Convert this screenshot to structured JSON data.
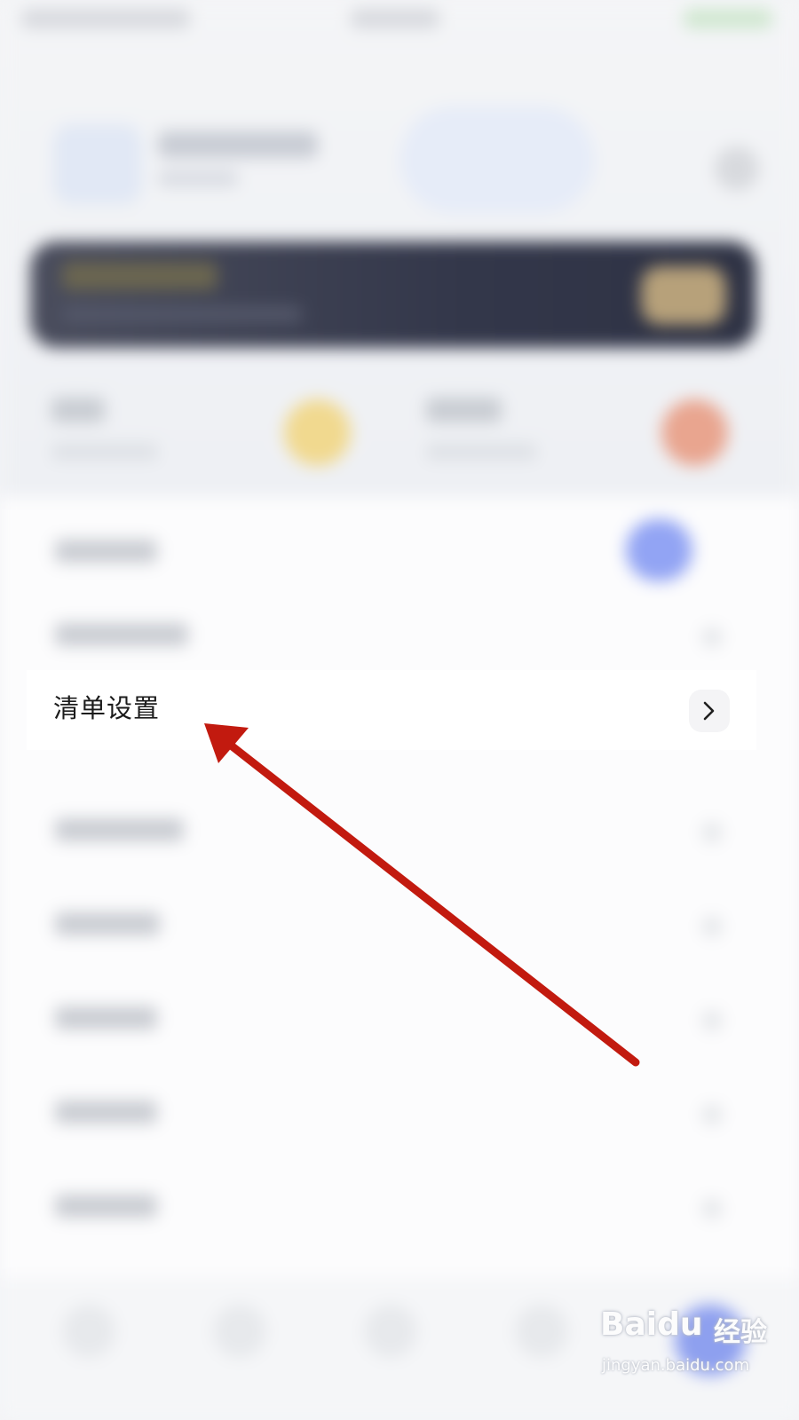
{
  "settings": {
    "list_settings_label": "清单设置"
  },
  "colors": {
    "annotation_arrow": "#c21a0f"
  },
  "watermark": {
    "logo_text": "Baidu",
    "cn_text": "经验",
    "url": "jingyan.baidu.com"
  }
}
